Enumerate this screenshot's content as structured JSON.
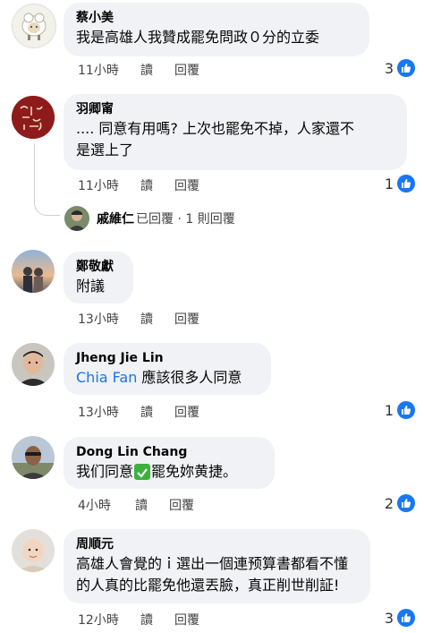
{
  "comments": [
    {
      "name": "蔡小美",
      "lines": [
        "我是高雄人我贊成罷免問政０分的立委"
      ],
      "time": "11小時",
      "read": "讀",
      "reply": "回覆",
      "count": "3"
    },
    {
      "name": "羽卿甯",
      "lines": [
        ".... 同意有用嗎? 上次也罷免不掉，人家還不",
        "是選上了"
      ],
      "time": "11小時",
      "read": "讀",
      "reply": "回覆",
      "count": "1",
      "replies": {
        "name": "戚維仁",
        "suffix": "已回覆 · 1 則回覆"
      }
    },
    {
      "name": "鄭敬獻",
      "lines": [
        "附議"
      ],
      "time": "13小時",
      "read": "讀",
      "reply": "回覆"
    },
    {
      "name": "Jheng Jie Lin",
      "mention": "Chia Fan",
      "lines": [
        " 應該很多人同意"
      ],
      "time": "13小時",
      "read": "讀",
      "reply": "回覆",
      "count": "1"
    },
    {
      "name": "Dong Lin Chang",
      "lines_before": "我们同意",
      "lines_after": "罷免妳黄捷。",
      "time": "4小時",
      "read": "讀",
      "reply": "回覆",
      "count": "2"
    },
    {
      "name": "周順元",
      "lines": [
        "高雄人會覺的ｉ選出一個連预算書都看不懂",
        "的人真的比罷免他還丟臉，真正削世削証!"
      ],
      "time": "12小時",
      "read": "讀",
      "reply": "回覆",
      "count": "3"
    }
  ],
  "colors": {
    "like": "#1877f2",
    "bubble": "#f0f2f5",
    "mention": "#1b74e4"
  },
  "icons": {
    "like": "thumbs-up-icon",
    "check": "check-mark-icon"
  }
}
